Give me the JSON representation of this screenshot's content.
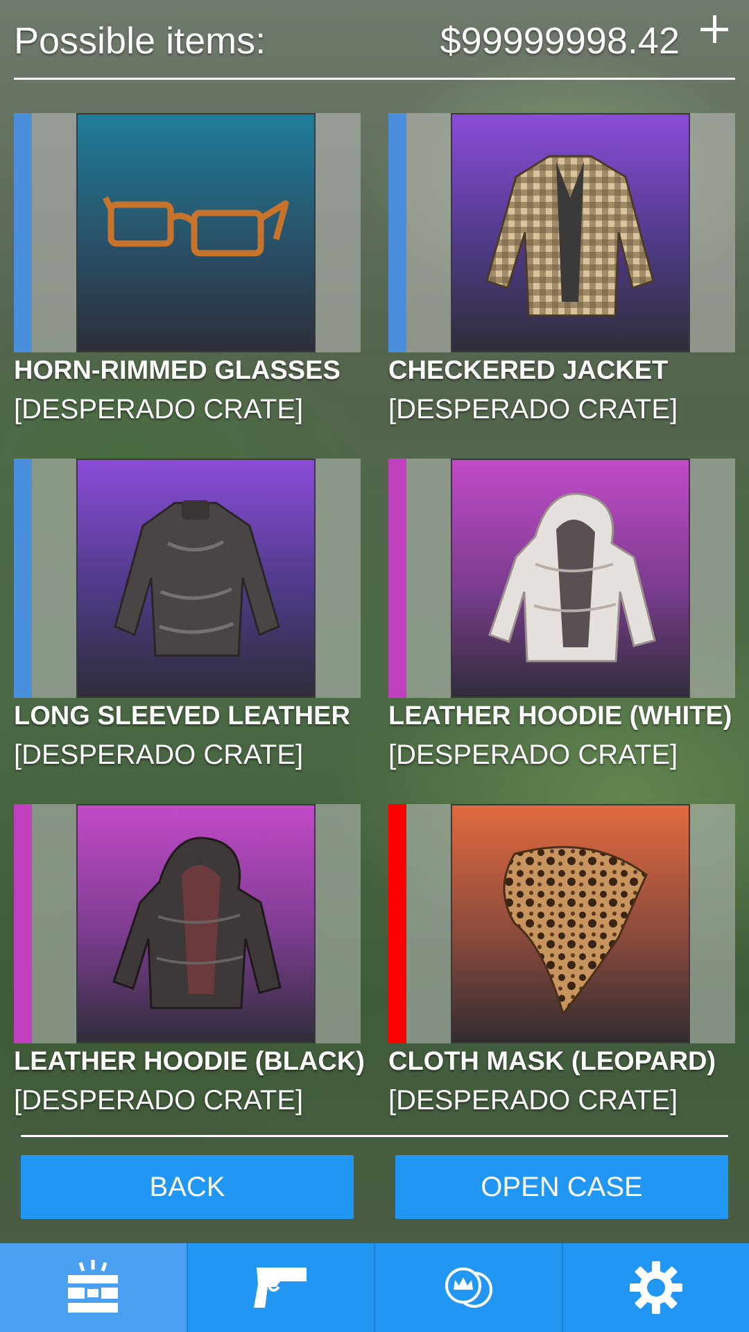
{
  "header": {
    "title": "Possible items:",
    "balance": "$99999998.42"
  },
  "items": [
    {
      "name": "HORN-RIMMED GLASSES",
      "crate": "[DESPERADO CRATE]",
      "rarity_color": "#4a8fdc",
      "art": "glasses"
    },
    {
      "name": "CHECKERED JACKET",
      "crate": "[DESPERADO CRATE]",
      "rarity_color": "#4a8fdc",
      "art": "jacket"
    },
    {
      "name": "LONG SLEEVED LEATHER",
      "crate": "[DESPERADO CRATE]",
      "rarity_color": "#4a8fdc",
      "art": "leather"
    },
    {
      "name": "LEATHER HOODIE (WHITE)",
      "crate": "[DESPERADO CRATE]",
      "rarity_color": "#c040c0",
      "art": "hoodie-white"
    },
    {
      "name": "LEATHER HOODIE (BLACK)",
      "crate": "[DESPERADO CRATE]",
      "rarity_color": "#c040c0",
      "art": "hoodie-black"
    },
    {
      "name": "CLOTH MASK (LEOPARD)",
      "crate": "[DESPERADO CRATE]",
      "rarity_color": "#ff0000",
      "art": "mask"
    }
  ],
  "buttons": {
    "back": "BACK",
    "open_case": "OPEN CASE"
  },
  "navbar": {
    "tabs": [
      {
        "icon": "crate-icon",
        "active": true
      },
      {
        "icon": "pistol-icon",
        "active": false
      },
      {
        "icon": "coins-icon",
        "active": false
      },
      {
        "icon": "gear-icon",
        "active": false
      }
    ]
  },
  "colors": {
    "accent": "#2196f3",
    "rarity_blue": "#4a8fdc",
    "rarity_purple": "#c040c0",
    "rarity_red": "#ff0000"
  }
}
